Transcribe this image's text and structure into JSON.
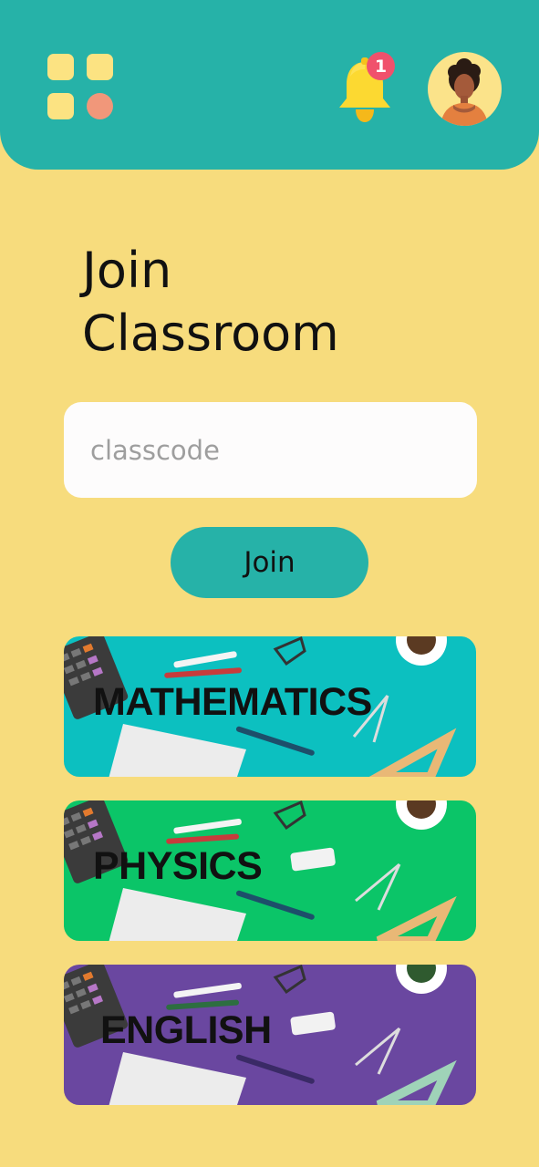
{
  "header": {
    "notification_count": "1",
    "colors": {
      "bar": "#26b2a8",
      "bell": "#fcd931",
      "badge": "#f0516c"
    }
  },
  "main": {
    "title_line1": "Join",
    "title_line2": "Classroom",
    "classcode_placeholder": "classcode",
    "classcode_value": "",
    "join_label": "Join"
  },
  "subjects": [
    {
      "label": "MATHEMATICS",
      "color": "#0cc0c0"
    },
    {
      "label": "PHYSICS",
      "color": "#0bc568"
    },
    {
      "label": "ENGLISH",
      "color": "#6a47a0"
    }
  ],
  "icons": {
    "menu": "grid-menu-icon",
    "notifications": "bell-icon",
    "profile": "user-avatar"
  }
}
